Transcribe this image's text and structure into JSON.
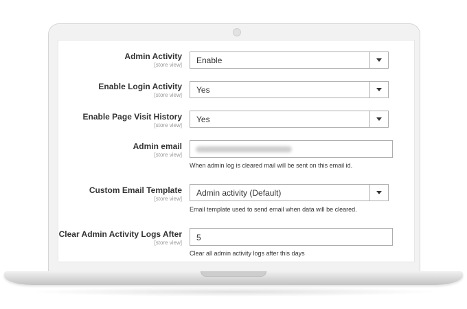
{
  "form": {
    "rows": [
      {
        "label": "Admin Activity",
        "scope": "[store view]",
        "value": "Enable"
      },
      {
        "label": "Enable Login Activity",
        "scope": "[store view]",
        "value": "Yes"
      },
      {
        "label": "Enable Page Visit History",
        "scope": "[store view]",
        "value": "Yes"
      },
      {
        "label": "Admin email",
        "scope": "[store view]",
        "value": "",
        "note": "When admin log is cleared mail will be sent on this email id."
      },
      {
        "label": "Custom Email Template",
        "scope": "[store view]",
        "value": "Admin activity (Default)",
        "note": "Email template used to send email when data will be cleared."
      },
      {
        "label": "Clear Admin Activity Logs After",
        "scope": "[store view]",
        "value": "5",
        "note": "Clear all admin activity logs after this days"
      }
    ]
  },
  "icons": {
    "dropdown": "chevron-down-icon",
    "camera": "camera-icon"
  }
}
